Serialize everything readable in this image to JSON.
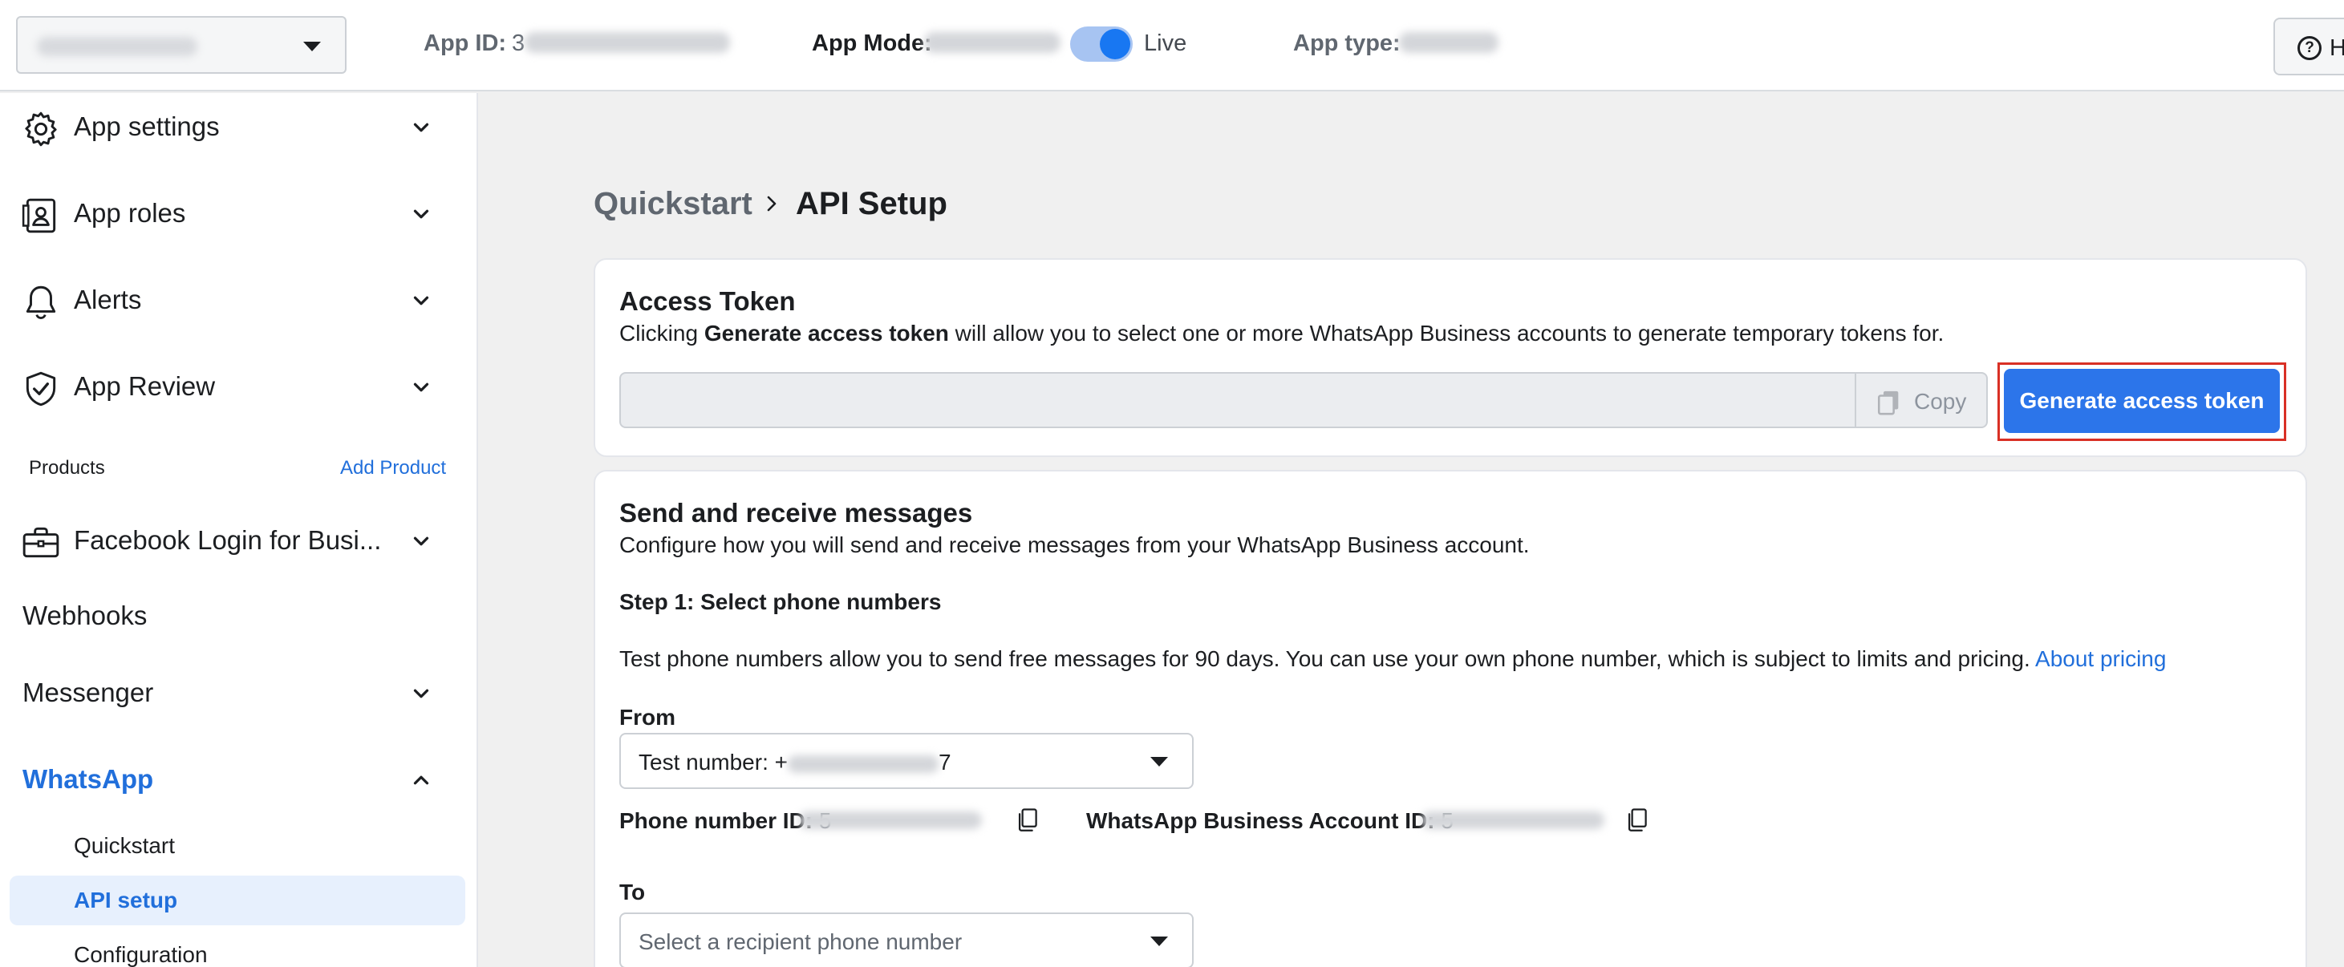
{
  "topbar": {
    "app_id_label": "App ID:",
    "app_id_visible": "3",
    "app_mode_label": "App Mode:",
    "live_label": "Live",
    "app_type_label": "App type:",
    "help_label": "H"
  },
  "sidebar": {
    "items": [
      {
        "label": "App settings",
        "icon": "gear-icon"
      },
      {
        "label": "App roles",
        "icon": "person-card-icon"
      },
      {
        "label": "Alerts",
        "icon": "bell-icon"
      },
      {
        "label": "App Review",
        "icon": "shield-check-icon"
      }
    ],
    "products_label": "Products",
    "add_product_label": "Add Product",
    "facebook_login_label": "Facebook Login for Busi...",
    "webhooks_label": "Webhooks",
    "messenger_label": "Messenger",
    "whatsapp_label": "WhatsApp",
    "whatsapp_sub": [
      {
        "label": "Quickstart"
      },
      {
        "label": "API setup"
      },
      {
        "label": "Configuration"
      }
    ]
  },
  "breadcrumb": {
    "parent": "Quickstart",
    "current": "API Setup"
  },
  "access_token": {
    "title": "Access Token",
    "desc_prefix": "Clicking ",
    "desc_bold": "Generate access token",
    "desc_suffix": " will allow you to select one or more WhatsApp Business accounts to generate temporary tokens for.",
    "copy_label": "Copy",
    "generate_label": "Generate access token"
  },
  "messages": {
    "title": "Send and receive messages",
    "desc": "Configure how you will send and receive messages from your WhatsApp Business account.",
    "step1": "Step 1: Select phone numbers",
    "info_text": "Test phone numbers allow you to send free messages for 90 days. You can use your own phone number, which is subject to limits and pricing. ",
    "about_pricing": "About pricing",
    "from_label": "From",
    "from_prefix": "Test number: +",
    "from_suffix": "7",
    "phone_id_label": "Phone number ID: ",
    "phone_id_visible": "5",
    "waba_id_label": "WhatsApp Business Account ID: ",
    "waba_id_visible": "5",
    "to_label": "To",
    "to_placeholder": "Select a recipient phone number"
  },
  "colors": {
    "accent": "#216fdb",
    "primary_button": "#2c75ea",
    "highlight_outline": "#d93025"
  }
}
